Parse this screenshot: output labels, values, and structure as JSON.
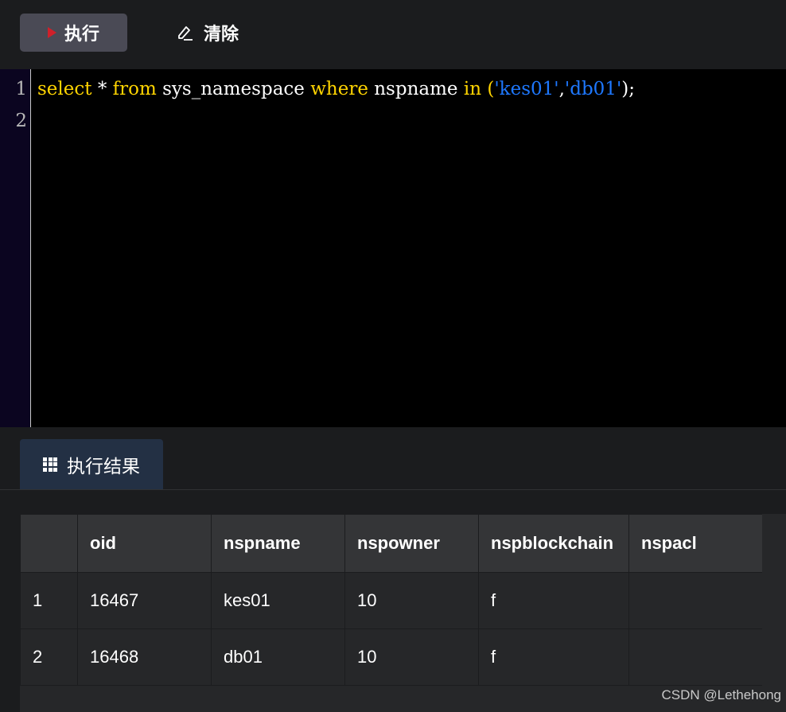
{
  "toolbar": {
    "run_label": "执行",
    "clear_label": "清除",
    "accent_color": "#d0202a"
  },
  "editor": {
    "line_numbers": [
      "1",
      "2"
    ],
    "code": {
      "select": "select",
      "star": " * ",
      "from": "from",
      "table": " sys_namespace ",
      "where": "where",
      "column": " nspname ",
      "in": "in",
      "open_paren": " (",
      "str1": "'kes01'",
      "comma": ",",
      "str2": "'db01'",
      "close": ");"
    }
  },
  "results": {
    "tab_label": "执行结果",
    "columns": [
      "",
      "oid",
      "nspname",
      "nspowner",
      "nspblockchain",
      "nspacl"
    ],
    "rows": [
      [
        "1",
        "16467",
        "kes01",
        "10",
        "f",
        ""
      ],
      [
        "2",
        "16468",
        "db01",
        "10",
        "f",
        ""
      ]
    ]
  },
  "watermark": "CSDN @Lethehong"
}
